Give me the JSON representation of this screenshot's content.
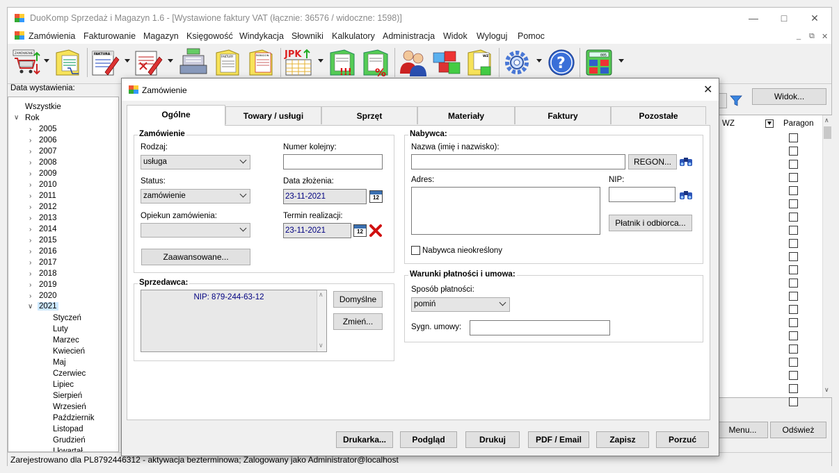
{
  "app": {
    "title": "DuoKomp Sprzedaż i Magazyn 1.6 - [Wystawione faktury VAT (łącznie: 36576 / widoczne: 1598)]",
    "menu": [
      "Zamówienia",
      "Fakturowanie",
      "Magazyn",
      "Księgowość",
      "Windykacja",
      "Słowniki",
      "Kalkulatory",
      "Administracja",
      "Widok",
      "Wyloguj",
      "Pomoc"
    ],
    "toolbar_badges": {
      "zam": "ZAMÓWIENIE",
      "fak": "FAKTURA",
      "jpk": "JPK",
      "fakt2": "FAKTURY",
      "paragon": "PARAGON",
      "calc": "005"
    }
  },
  "left_panel": {
    "label": "Data wystawienia:",
    "tree": {
      "all": "Wszystkie",
      "root": "Rok",
      "years": [
        "2005",
        "2006",
        "2007",
        "2008",
        "2009",
        "2010",
        "2011",
        "2012",
        "2013",
        "2014",
        "2015",
        "2016",
        "2017",
        "2018",
        "2019",
        "2020"
      ],
      "current_year": "2021",
      "months": [
        "Styczeń",
        "Luty",
        "Marzec",
        "Kwiecień",
        "Maj",
        "Czerwiec",
        "Lipiec",
        "Sierpień",
        "Wrzesień",
        "Październik",
        "Listopad",
        "Grudzień",
        "I kwartał"
      ]
    }
  },
  "right_panel": {
    "view_button": "Widok...",
    "col_wz": "WZ",
    "col_paragon": "Paragon",
    "menu_button": "Menu...",
    "refresh_button": "Odśwież"
  },
  "status_bar": "Zarejestrowano dla PL8792446312 - aktywacja bezterminowa;  Zalogowany jako Administrator@localhost",
  "dialog": {
    "title": "Zamówienie",
    "tabs": [
      "Ogólne",
      "Towary / usługi",
      "Sprzęt",
      "Materiały",
      "Faktury",
      "Pozostałe"
    ],
    "zamowienie": {
      "group": "Zamówienie",
      "rodzaj_label": "Rodzaj:",
      "rodzaj_value": "usługa",
      "numer_label": "Numer kolejny:",
      "status_label": "Status:",
      "status_value": "zamówienie",
      "data_label": "Data złożenia:",
      "data_value": "23-11-2021",
      "opiekun_label": "Opiekun zamówienia:",
      "termin_label": "Termin realizacji:",
      "termin_value": "23-11-2021",
      "advanced_button": "Zaawansowane...",
      "cal_day": "12"
    },
    "sprzedawca": {
      "group": "Sprzedawca:",
      "nip": "NIP: 879-244-63-12",
      "default_button": "Domyślne",
      "change_button": "Zmień..."
    },
    "nabywca": {
      "group": "Nabywca:",
      "name_label": "Nazwa (imię i nazwisko):",
      "regon_button": "REGON...",
      "address_label": "Adres:",
      "nip_label": "NIP:",
      "payer_button": "Płatnik i odbiorca...",
      "undefined_label": "Nabywca nieokreślony"
    },
    "warunki": {
      "group": "Warunki płatności i umowa:",
      "payment_label": "Sposób płatności:",
      "payment_value": "pomiń",
      "contract_label": "Sygn. umowy:"
    },
    "footer": [
      "Drukarka...",
      "Podgląd",
      "Drukuj",
      "PDF / Email",
      "Zapisz",
      "Porzuć"
    ]
  }
}
